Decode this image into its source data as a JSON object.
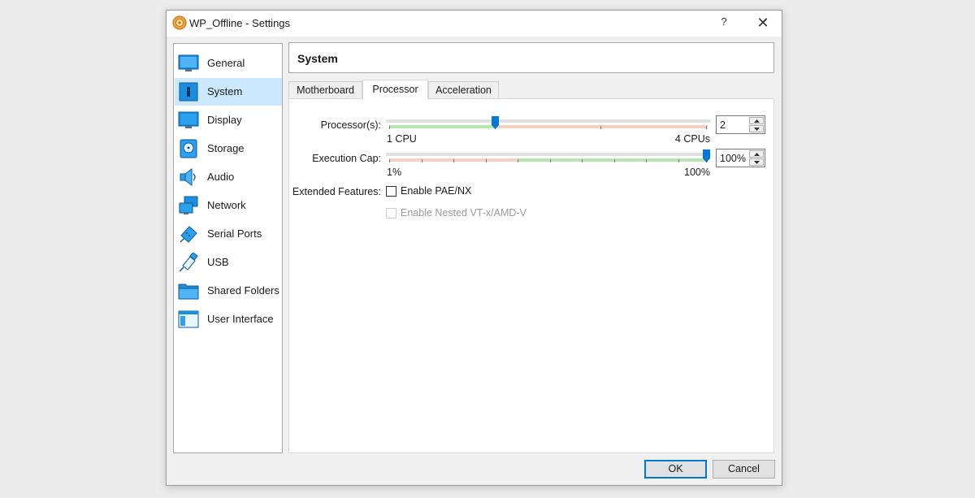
{
  "window": {
    "title": "WP_Offline - Settings",
    "help_label": "?",
    "close_label": "✕"
  },
  "sidebar": {
    "items": [
      {
        "label": "General",
        "icon": "general-icon"
      },
      {
        "label": "System",
        "icon": "system-icon",
        "selected": true
      },
      {
        "label": "Display",
        "icon": "display-icon"
      },
      {
        "label": "Storage",
        "icon": "storage-icon"
      },
      {
        "label": "Audio",
        "icon": "audio-icon"
      },
      {
        "label": "Network",
        "icon": "network-icon"
      },
      {
        "label": "Serial Ports",
        "icon": "serial-ports-icon"
      },
      {
        "label": "USB",
        "icon": "usb-icon"
      },
      {
        "label": "Shared Folders",
        "icon": "shared-folders-icon"
      },
      {
        "label": "User Interface",
        "icon": "user-interface-icon"
      }
    ]
  },
  "header": {
    "title": "System"
  },
  "tabs": [
    {
      "label": "Motherboard"
    },
    {
      "label": "Processor",
      "active": true
    },
    {
      "label": "Acceleration"
    }
  ],
  "processor": {
    "processors_label": "Processor(s):",
    "processors_value": "2",
    "processors_min_label": "1 CPU",
    "processors_max_label": "4 CPUs",
    "processors_current": 2,
    "processors_min": 1,
    "processors_max": 4,
    "exec_cap_label": "Execution Cap:",
    "exec_cap_value": "100%",
    "exec_cap_min_label": "1%",
    "exec_cap_max_label": "100%",
    "exec_cap_current": 100,
    "extended_features_label": "Extended Features:",
    "enable_pae_label": "Enable PAE/NX",
    "enable_pae_checked": false,
    "enable_nested_label": "Enable Nested VT-x/AMD-V",
    "enable_nested_checked": false,
    "enable_nested_enabled": false
  },
  "footer": {
    "ok_label": "OK",
    "cancel_label": "Cancel"
  },
  "colors": {
    "accent": "#0078d7",
    "selected_bg": "#cce8ff",
    "green_zone": "#b8e6b0",
    "red_zone": "#f5d0c3"
  }
}
